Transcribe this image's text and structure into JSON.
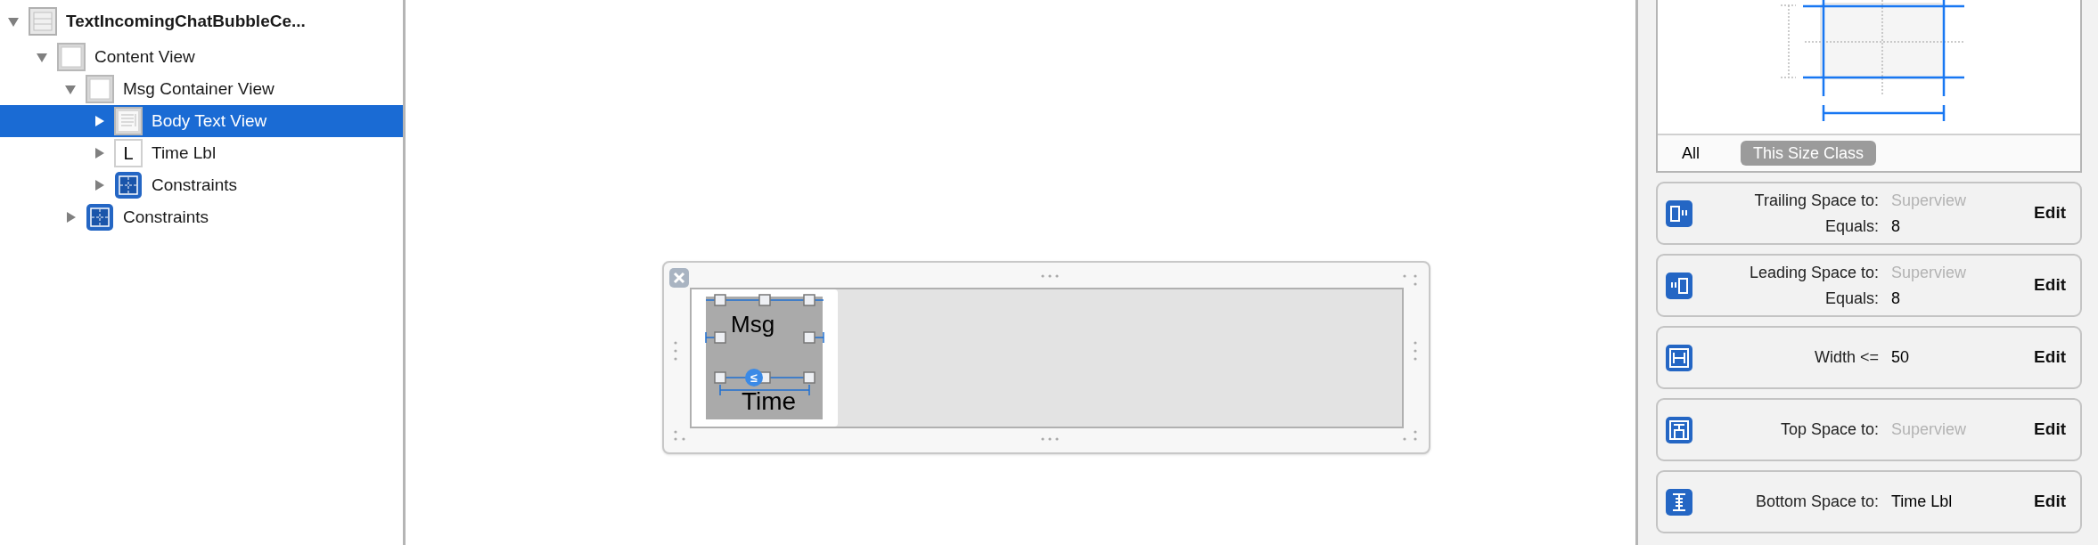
{
  "outline": [
    {
      "label": "TextIncomingChatBubbleCe...",
      "kind": "cell",
      "expanded": true,
      "selected": false,
      "children": [
        {
          "label": "Content View",
          "kind": "view",
          "expanded": true,
          "selected": false,
          "children": [
            {
              "label": "Msg Container View",
              "kind": "view",
              "expanded": true,
              "selected": false,
              "children": [
                {
                  "label": "Body Text View",
                  "kind": "text-view",
                  "expanded": false,
                  "selected": true
                },
                {
                  "label": "Time Lbl",
                  "kind": "label",
                  "glyph": "L",
                  "expanded": false,
                  "selected": false
                },
                {
                  "label": "Constraints",
                  "kind": "constraints",
                  "expanded": false,
                  "selected": false
                }
              ]
            },
            {
              "label": "Constraints",
              "kind": "constraints",
              "expanded": false,
              "selected": false
            }
          ]
        }
      ]
    }
  ],
  "canvas": {
    "labels": [
      "Msg",
      "Time"
    ],
    "badge": "≤"
  },
  "inspector": {
    "size_class_tabs": [
      {
        "label": "All",
        "selected": false
      },
      {
        "label": "This Size Class",
        "selected": true
      }
    ],
    "constraints": [
      {
        "kind": "trailing",
        "lines": [
          {
            "label": "Trailing Space to:",
            "value": "Superview",
            "dimmed": true
          },
          {
            "label": "Equals:",
            "value": "8",
            "dimmed": false
          }
        ],
        "action": "Edit"
      },
      {
        "kind": "leading",
        "lines": [
          {
            "label": "Leading Space to:",
            "value": "Superview",
            "dimmed": true
          },
          {
            "label": "Equals:",
            "value": "8",
            "dimmed": false
          }
        ],
        "action": "Edit"
      },
      {
        "kind": "width",
        "lines": [
          {
            "label": "Width <=",
            "value": "50",
            "dimmed": false
          }
        ],
        "action": "Edit"
      },
      {
        "kind": "top",
        "lines": [
          {
            "label": "Top Space to:",
            "value": "Superview",
            "dimmed": true
          }
        ],
        "action": "Edit"
      },
      {
        "kind": "bottom",
        "lines": [
          {
            "label": "Bottom Space to:",
            "value": "Time Lbl",
            "dimmed": false
          }
        ],
        "action": "Edit"
      }
    ]
  }
}
